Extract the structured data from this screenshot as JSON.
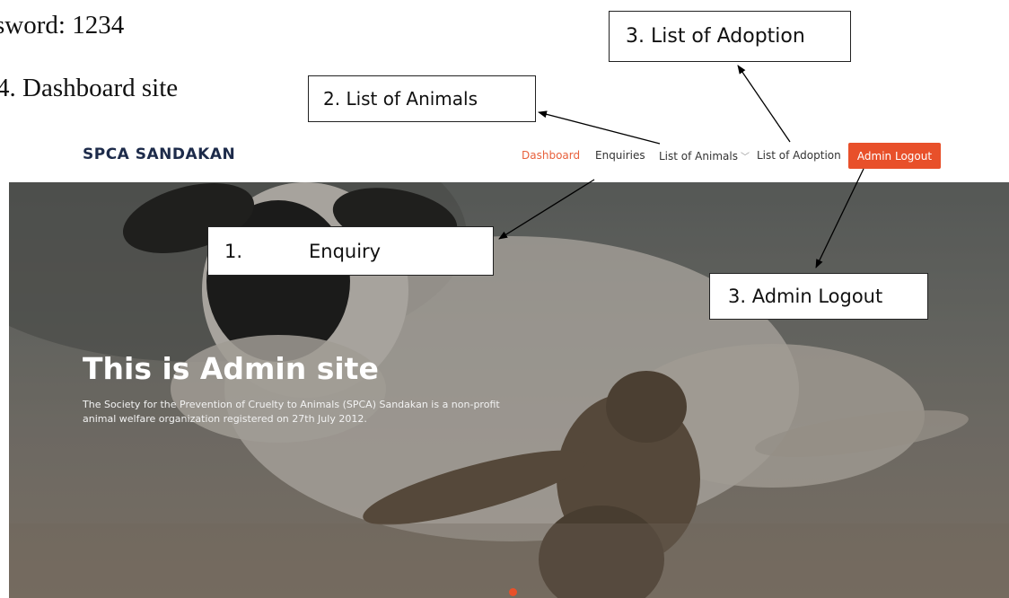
{
  "document": {
    "line1": "sword: 1234",
    "line2": "4.  Dashboard site"
  },
  "callouts": {
    "adoption": "3. List of Adoption",
    "animals": "2. List of Animals",
    "enquiry_number": "1.",
    "enquiry_label": "Enquiry",
    "logout": "3. Admin Logout"
  },
  "site": {
    "brand": "SPCA SANDAKAN",
    "nav": {
      "dashboard": "Dashboard",
      "enquiries": "Enquiries",
      "animals": "List of Animals",
      "adoption": "List of Adoption",
      "logout": "Admin Logout"
    },
    "hero": {
      "title": "This is Admin site",
      "desc_line1": "The Society for the Prevention of Cruelty to Animals (SPCA) Sandakan is a non-profit",
      "desc_line2": "animal welfare organization registered on 27th July 2012."
    }
  },
  "icons": {
    "dropdown": "chevron-down-icon"
  },
  "colors": {
    "accent": "#e8502a",
    "brand": "#1d2b4a",
    "active_nav": "#e8613c"
  }
}
